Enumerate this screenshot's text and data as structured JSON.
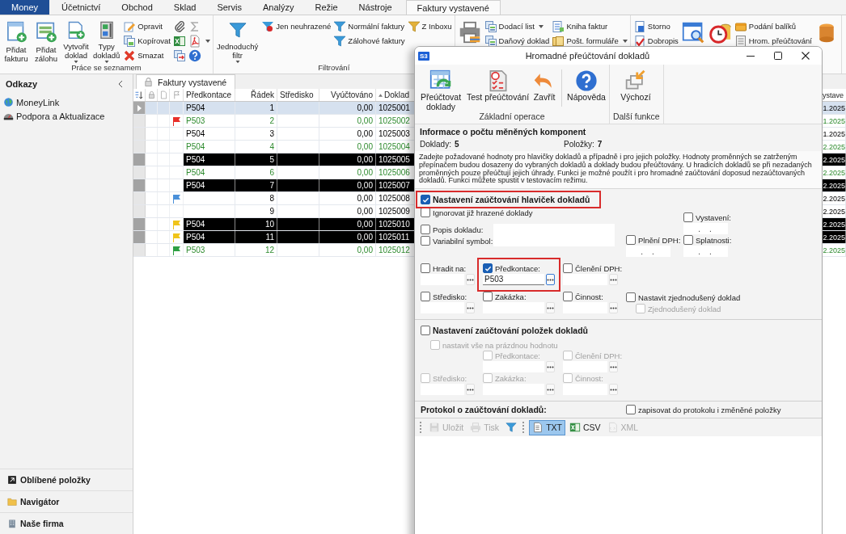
{
  "app_tabs": [
    {
      "label": "Money",
      "kind": "app"
    },
    {
      "label": "Účetnictví",
      "kind": "tab",
      "selected": false
    },
    {
      "label": "Obchod",
      "kind": "tab",
      "selected": false
    },
    {
      "label": "Sklad",
      "kind": "tab",
      "selected": false
    },
    {
      "label": "Servis",
      "kind": "tab",
      "selected": false
    },
    {
      "label": "Analýzy",
      "kind": "tab",
      "selected": false
    },
    {
      "label": "Režie",
      "kind": "tab",
      "selected": false
    },
    {
      "label": "Nástroje",
      "kind": "tab",
      "selected": false
    },
    {
      "label": "Faktury vystavené",
      "kind": "tab",
      "selected": true
    }
  ],
  "ribbon": {
    "groups": [
      {
        "label": "Práce se seznamem",
        "columns": [
          {
            "kind": "big",
            "items": [
              {
                "label": "Přidat fakturu",
                "dropdown": false
              }
            ]
          },
          {
            "kind": "big",
            "items": [
              {
                "label": "Přidat zálohu",
                "dropdown": false
              }
            ]
          },
          {
            "kind": "big",
            "items": [
              {
                "label": "Vytvořit doklad",
                "dropdown": true
              }
            ]
          },
          {
            "kind": "big",
            "items": [
              {
                "label": "Typy dokladů",
                "dropdown": true
              }
            ]
          },
          {
            "kind": "small",
            "items": [
              {
                "label": "Opravit",
                "dropdown": false
              },
              {
                "label": "Kopírovat",
                "dropdown": false
              },
              {
                "label": "Smazat",
                "dropdown": false
              }
            ]
          },
          {
            "kind": "icons",
            "items": [
              {
                "dropdown": false
              },
              {
                "dropdown": false
              },
              {
                "dropdown": false
              }
            ]
          },
          {
            "kind": "icons",
            "items": [
              {
                "dropdown": false
              },
              {
                "dropdown": true
              },
              {
                "dropdown": false
              }
            ]
          }
        ]
      },
      {
        "label": "Filtrování",
        "columns": [
          {
            "kind": "big",
            "items": [
              {
                "label": "Jednoduchý filtr",
                "dropdown": true
              }
            ]
          },
          {
            "kind": "small",
            "items": [
              {
                "label": "Jen neuhrazené",
                "dropdown": false
              }
            ]
          },
          {
            "kind": "small",
            "items": [
              {
                "label": "Normální faktury",
                "dropdown": false
              },
              {
                "label": "Zálohové faktury",
                "dropdown": false
              }
            ]
          },
          {
            "kind": "small",
            "items": [
              {
                "label": "Z Inboxu",
                "dropdown": false
              }
            ]
          }
        ]
      },
      {
        "columns": [
          {
            "kind": "big",
            "items": [
              {
                "dropdown": false
              }
            ]
          },
          {
            "kind": "small",
            "items": [
              {
                "label": "Dodací list",
                "dropdown": true
              },
              {
                "label": "Daňový doklad",
                "dropdown": false
              }
            ]
          },
          {
            "kind": "small",
            "items": [
              {
                "label": "Kniha faktur",
                "dropdown": false
              },
              {
                "label": "Pošt. formuláře",
                "dropdown": true
              }
            ]
          }
        ]
      },
      {
        "columns": [
          {
            "kind": "small",
            "items": [
              {
                "label": "Storno",
                "dropdown": false
              },
              {
                "label": "Dobropis",
                "dropdown": false
              }
            ]
          },
          {
            "kind": "big",
            "items": [
              {
                "dropdown": false
              }
            ]
          },
          {
            "kind": "big",
            "items": [
              {
                "dropdown": false
              }
            ]
          },
          {
            "kind": "small",
            "items": [
              {
                "label": "Podání balíků",
                "dropdown": false
              },
              {
                "label": "Hrom. přeúčtování",
                "dropdown": false
              }
            ]
          },
          {
            "kind": "big",
            "items": [
              {
                "dropdown": false
              }
            ]
          }
        ]
      }
    ]
  },
  "sidebar": {
    "title": "Odkazy",
    "links": [
      {
        "label": "MoneyLink"
      },
      {
        "label": "Podpora a Aktualizace"
      }
    ],
    "bottom": [
      {
        "label": "Oblíbené položky"
      },
      {
        "label": "Navigátor"
      },
      {
        "label": "Naše firma"
      }
    ]
  },
  "document_tab": {
    "label": "Faktury vystavené"
  },
  "table": {
    "columns": [
      {
        "label": "Předkontace",
        "sorted": false
      },
      {
        "label": "Řádek",
        "sorted": false
      },
      {
        "label": "Středisko",
        "sorted": false
      },
      {
        "label": "Vyúčtováno",
        "sorted": false
      },
      {
        "label": "Doklad",
        "sorted": true
      },
      {
        "label": "ystave"
      }
    ],
    "rows": [
      {
        "selected": true,
        "marked": false,
        "accented": false,
        "predkontace": "P504",
        "radek": "1",
        "vyuctovano": "0,00",
        "doklad": "1025001",
        "column_6": "1.2025"
      },
      {
        "selected": false,
        "marked": false,
        "accented": true,
        "flag": {
          "color": "#e8302a"
        },
        "predkontace": "P503",
        "radek": "2",
        "vyuctovano": "0,00",
        "doklad": "1025002",
        "column_6": "1.2025"
      },
      {
        "selected": false,
        "marked": false,
        "accented": false,
        "predkontace": "P504",
        "radek": "3",
        "vyuctovano": "0,00",
        "doklad": "1025003",
        "column_6": "1.2025"
      },
      {
        "selected": false,
        "marked": false,
        "accented": true,
        "predkontace": "P504",
        "radek": "4",
        "vyuctovano": "0,00",
        "doklad": "1025004",
        "column_6": "2.2025"
      },
      {
        "selected": false,
        "marked": true,
        "predkontace": "P504",
        "radek": "5",
        "vyuctovano": "0,00",
        "doklad": "1025005",
        "column_6": "2.2025"
      },
      {
        "selected": false,
        "marked": false,
        "accented": true,
        "predkontace": "P504",
        "radek": "6",
        "vyuctovano": "0,00",
        "doklad": "1025006",
        "column_6": "2.2025"
      },
      {
        "selected": false,
        "marked": true,
        "predkontace": "P504",
        "radek": "7",
        "vyuctovano": "0,00",
        "doklad": "1025007",
        "column_6": "2.2025"
      },
      {
        "selected": false,
        "marked": false,
        "accented": false,
        "flag": {
          "color": "#4a90d9"
        },
        "radek": "8",
        "vyuctovano": "0,00",
        "doklad": "1025008",
        "column_6": "2.2025"
      },
      {
        "selected": false,
        "marked": false,
        "accented": false,
        "radek": "9",
        "vyuctovano": "0,00",
        "doklad": "1025009",
        "column_6": "2.2025"
      },
      {
        "selected": false,
        "marked": true,
        "flag": {
          "color": "#f0c419"
        },
        "predkontace": "P504",
        "radek": "10",
        "vyuctovano": "0,00",
        "doklad": "1025010",
        "column_6": "2.2025"
      },
      {
        "selected": false,
        "marked": true,
        "flag": {
          "color": "#f0c419"
        },
        "predkontace": "P504",
        "radek": "11",
        "vyuctovano": "0,00",
        "doklad": "1025011",
        "column_6": "2.2025"
      },
      {
        "selected": false,
        "marked": false,
        "accented": true,
        "flag": {
          "color": "#2ea043"
        },
        "predkontace": "P503",
        "radek": "12",
        "vyuctovano": "0,00",
        "doklad": "1025012",
        "column_6": "2.2025"
      }
    ]
  },
  "dialog": {
    "badge": "S3",
    "title": "Hromadné přeúčtování dokladů",
    "toolbar": [
      {
        "label": "Základní operace",
        "buttons": [
          {
            "label": "Přeúčtovat doklady",
            "separator_before": false
          },
          {
            "label": "Test přeúčtování",
            "separator_before": false
          },
          {
            "label": "Zavřít",
            "separator_before": false
          },
          {
            "label": "Nápověda",
            "separator_before": true
          }
        ]
      },
      {
        "label": "Další funkce",
        "buttons": [
          {
            "label": "Výchozí",
            "separator_before": false
          }
        ]
      }
    ],
    "info": {
      "title": "Informace o počtu měněných komponent",
      "counts": [
        {
          "label": "Doklady:",
          "value": "5"
        },
        {
          "label": "Položky:",
          "value": "7"
        }
      ]
    },
    "description": "Zadejte požadované hodnoty pro hlavičky dokladů a případně i pro jejich položky. Hodnoty proměnných se zatrženým přepínačem budou dosazeny do vybraných dokladů a doklady budou přeúčtovány. U hradicích dokladů se při nezadaných proměnných pouze přeúčtují jejich úhrady. Funkci je možné použít i pro hromadné zaúčtování doposud nezaúčtovaných dokladů. Funkci můžete spustit v testovacím režimu.",
    "header_section": {
      "label": "Nastavení zaúčtování hlaviček dokladů",
      "checked": true,
      "highlighted": true,
      "fields": [
        {
          "kind": "checkbox",
          "label": "Ignorovat již hrazené doklady",
          "checked": false,
          "disabled": false,
          "highlighted": false
        },
        {
          "kind": "inline",
          "label": "Popis dokladu:",
          "checked": false,
          "disabled": false,
          "highlighted": false
        },
        {
          "kind": "date",
          "label": "Vystavení:",
          "value": ". .",
          "checked": false,
          "disabled": false,
          "highlighted": false
        },
        {
          "kind": "inline",
          "label": "Variabilní symbol:",
          "checked": false,
          "disabled": false,
          "highlighted": false
        },
        {
          "kind": "date",
          "label": "Plnění DPH:",
          "value": ". .",
          "checked": false,
          "disabled": false,
          "highlighted": false
        },
        {
          "kind": "date",
          "label": "Splatnosti:",
          "value": ". .",
          "checked": false,
          "disabled": false,
          "highlighted": false
        },
        {
          "kind": "lookup",
          "label": "Hradit na:",
          "checked": false,
          "disabled": false,
          "highlighted": false
        },
        {
          "kind": "lookup",
          "label": "Předkontace:",
          "value": "P503",
          "checked": true,
          "disabled": false,
          "highlighted": true
        },
        {
          "kind": "lookup",
          "label": "Členění DPH:",
          "checked": false,
          "disabled": false,
          "highlighted": false
        },
        {
          "kind": "lookup",
          "label": "Středisko:",
          "checked": false,
          "disabled": false,
          "highlighted": false
        },
        {
          "kind": "lookup",
          "label": "Zakázka:",
          "checked": false,
          "disabled": false,
          "highlighted": false
        },
        {
          "kind": "lookup",
          "label": "Činnost:",
          "checked": false,
          "disabled": false,
          "highlighted": false
        },
        {
          "kind": "checkbox",
          "label": "Nastavit zjednodušený doklad",
          "checked": false,
          "disabled": false,
          "highlighted": false
        },
        {
          "kind": "checkbox",
          "label": "Zjednodušený doklad",
          "checked": false,
          "disabled": true,
          "highlighted": false
        }
      ]
    },
    "items_section": {
      "label": "Nastavení zaúčtování položek dokladů",
      "checked": false,
      "highlighted": false,
      "fields": [
        {
          "kind": "checkbox",
          "label": "nastavit vše na prázdnou hodnotu",
          "checked": false,
          "disabled": true,
          "highlighted": false
        },
        {
          "kind": "lookup",
          "label": "Předkontace:",
          "checked": false,
          "disabled": true,
          "highlighted": false
        },
        {
          "kind": "lookup",
          "label": "Členění DPH:",
          "checked": false,
          "disabled": true,
          "highlighted": false
        },
        {
          "kind": "lookup",
          "label": "Středisko:",
          "checked": false,
          "disabled": true,
          "highlighted": false
        },
        {
          "kind": "lookup",
          "label": "Zakázka:",
          "checked": false,
          "disabled": true,
          "highlighted": false
        },
        {
          "kind": "lookup",
          "label": "Činnost:",
          "checked": false,
          "disabled": true,
          "highlighted": false
        }
      ]
    },
    "protocol": {
      "label": "Protokol o zaúčtování dokladů:",
      "option": {
        "label": "zapisovat do protokolu i změněné položky",
        "checked": false
      },
      "tools": [
        {
          "kind": "button",
          "label": "Uložit",
          "disabled": true,
          "selected": false
        },
        {
          "kind": "button",
          "label": "Tisk",
          "disabled": true,
          "selected": false
        },
        {
          "kind": "icon",
          "disabled": false,
          "selected": false
        },
        {
          "kind": "button",
          "label": "TXT",
          "disabled": false,
          "selected": true
        },
        {
          "kind": "button",
          "label": "CSV",
          "disabled": false,
          "selected": false
        },
        {
          "kind": "button",
          "label": "XML",
          "disabled": true,
          "selected": false
        }
      ]
    }
  }
}
